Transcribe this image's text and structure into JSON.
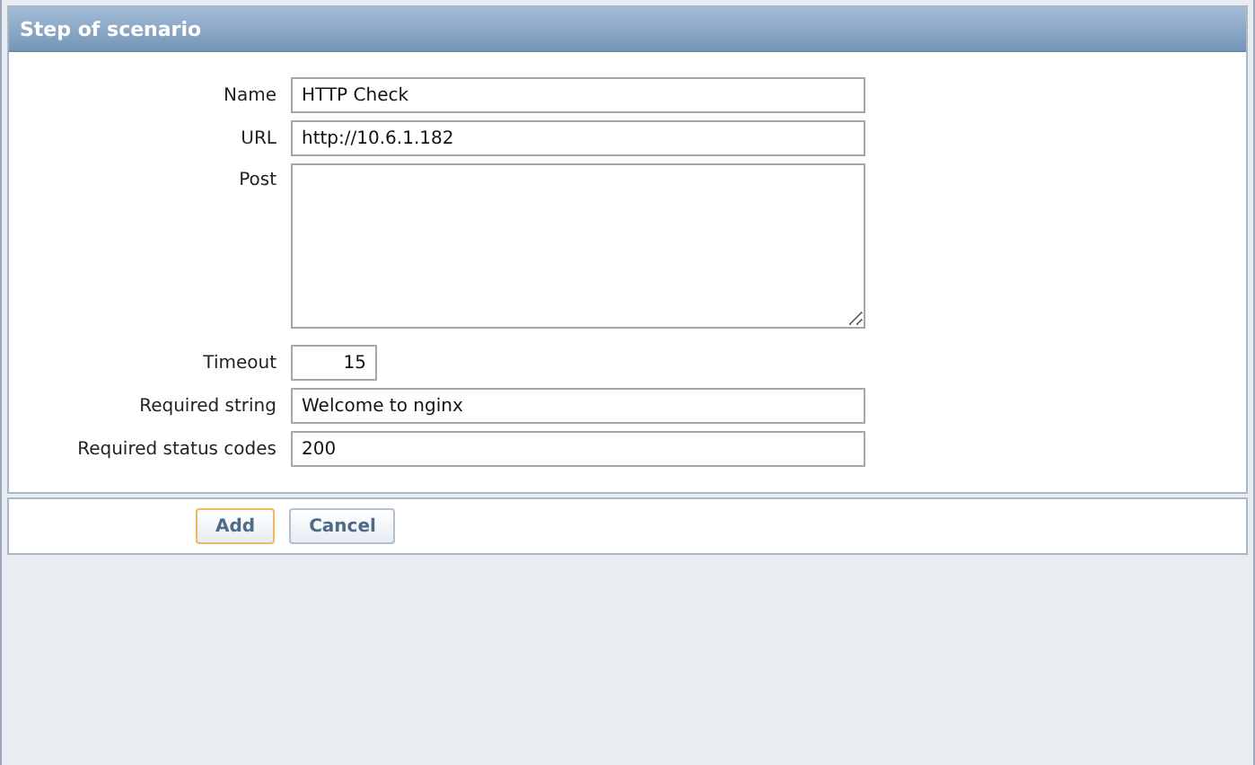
{
  "panel": {
    "title": "Step of scenario"
  },
  "fields": [
    {
      "label": "Name",
      "kind": "text",
      "value": "HTTP Check"
    },
    {
      "label": "URL",
      "kind": "text",
      "value": "http://10.6.1.182"
    },
    {
      "label": "Post",
      "kind": "textarea"
    },
    {
      "label": "Timeout",
      "kind": "number",
      "value": "15"
    },
    {
      "label": "Required string",
      "kind": "text",
      "value": "Welcome to nginx"
    },
    {
      "label": "Required status codes",
      "kind": "text",
      "value": "200"
    }
  ],
  "buttons": [
    {
      "label": "Add",
      "focused": true
    },
    {
      "label": "Cancel",
      "focused": false
    }
  ]
}
